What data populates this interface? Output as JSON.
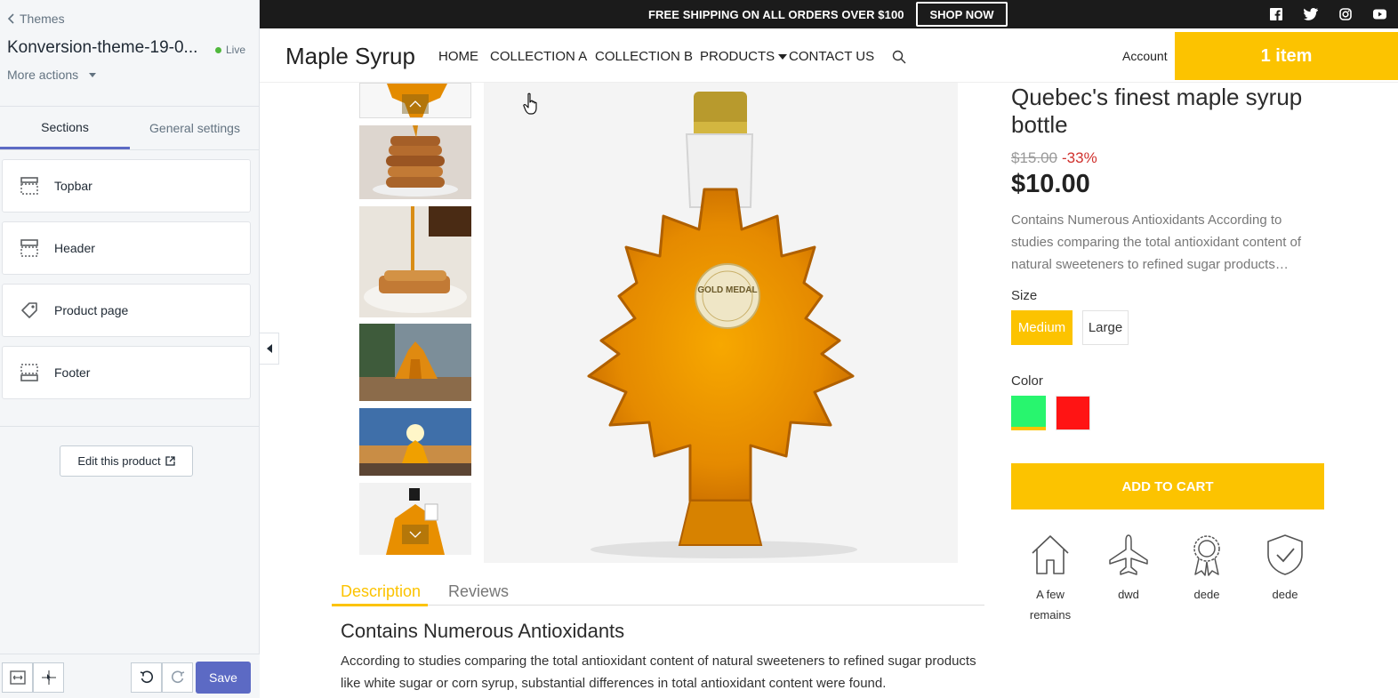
{
  "editor": {
    "back_label": "Themes",
    "theme_name": "Konversion-theme-19-0...",
    "live_label": "Live",
    "more_actions": "More actions",
    "tabs": [
      {
        "label": "Sections"
      },
      {
        "label": "General settings"
      }
    ],
    "sections": [
      {
        "label": "Topbar",
        "icon": "topbar-section-icon"
      },
      {
        "label": "Header",
        "icon": "header-section-icon"
      },
      {
        "label": "Product page",
        "icon": "tag-icon"
      },
      {
        "label": "Footer",
        "icon": "footer-section-icon"
      }
    ],
    "edit_product": "Edit this product",
    "save_label": "Save",
    "accent": "#5c6ac4"
  },
  "store": {
    "announcement": "FREE SHIPPING ON ALL ORDERS OVER $100",
    "shop_now": "SHOP NOW",
    "social_icons": [
      "facebook-icon",
      "twitter-icon",
      "instagram-icon",
      "youtube-icon"
    ],
    "logo": "Maple Syrup",
    "nav": [
      "HOME",
      "COLLECTION A",
      "COLLECTION B",
      "PRODUCTS",
      "CONTACT US"
    ],
    "account": "Account",
    "cart": "1 item",
    "accent": "#fcc300"
  },
  "product": {
    "title": "Quebec's finest maple syrup bottle",
    "old_price": "$15.00",
    "discount": "-33%",
    "price": "$10.00",
    "description": "Contains Numerous Antioxidants According to studies comparing the total antioxidant content of natural sweeteners to refined sugar products…",
    "size_label": "Size",
    "sizes": [
      "Medium",
      "Large"
    ],
    "selected_size": "Medium",
    "color_label": "Color",
    "colors": [
      "#28f56e",
      "#ff1414"
    ],
    "add_to_cart": "ADD TO CART",
    "features": [
      {
        "icon": "house-icon",
        "label": "A few remains"
      },
      {
        "icon": "airplane-icon",
        "label": "dwd"
      },
      {
        "icon": "award-icon",
        "label": "dede"
      },
      {
        "icon": "shield-check-icon",
        "label": "dede"
      }
    ],
    "medal_text": "GOLD MEDAL",
    "tabs": [
      "Description",
      "Reviews"
    ],
    "desc_heading": "Contains Numerous Antioxidants",
    "desc_text": "According to studies comparing the total antioxidant content of natural sweeteners to refined sugar products like white sugar or corn syrup, substantial differences in total antioxidant content were found."
  }
}
